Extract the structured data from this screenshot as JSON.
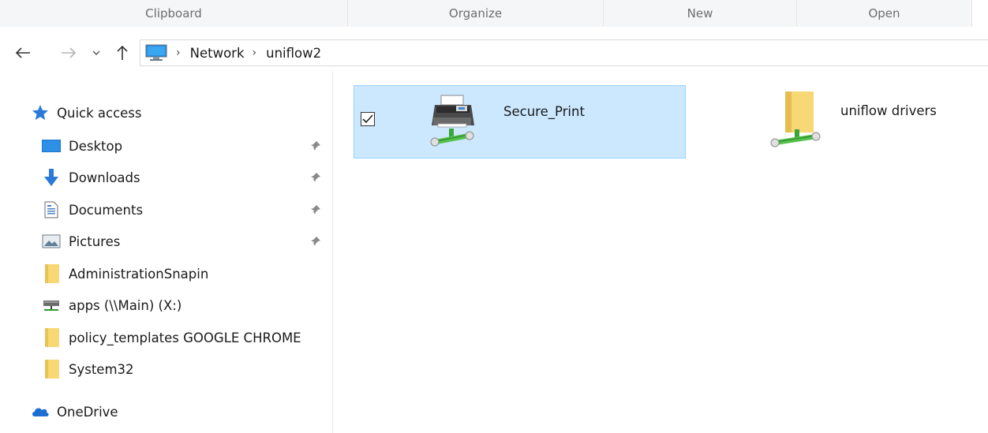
{
  "ribbon": {
    "groups": [
      "Clipboard",
      "Organize",
      "New",
      "Open"
    ]
  },
  "navbar": {
    "back_icon": "arrow-left-icon",
    "forward_icon": "arrow-right-icon",
    "recent_icon": "chevron-down-icon",
    "up_icon": "arrow-up-icon",
    "breadcrumb": [
      "Network",
      "uniflow2"
    ]
  },
  "nav_pane": {
    "quick_access": "Quick access",
    "items": [
      {
        "label": "Desktop",
        "icon": "desktop-icon",
        "pinned": true
      },
      {
        "label": "Downloads",
        "icon": "downloads-icon",
        "pinned": true
      },
      {
        "label": "Documents",
        "icon": "documents-icon",
        "pinned": true
      },
      {
        "label": "Pictures",
        "icon": "pictures-icon",
        "pinned": true
      },
      {
        "label": "AdministrationSnapin",
        "icon": "folder-icon",
        "pinned": false
      },
      {
        "label": "apps (\\\\Main) (X:)",
        "icon": "network-drive-icon",
        "pinned": false
      },
      {
        "label": "policy_templates GOOGLE CHROME",
        "icon": "folder-icon",
        "pinned": false
      },
      {
        "label": "System32",
        "icon": "folder-icon",
        "pinned": false
      }
    ],
    "onedrive": "OneDrive"
  },
  "content": {
    "tiles": [
      {
        "label": "Secure_Print",
        "icon": "network-printer-icon",
        "selected": true
      },
      {
        "label": "uniflow drivers",
        "icon": "network-folder-icon",
        "selected": false
      }
    ]
  },
  "colors": {
    "selection_fill": "#cce8ff",
    "selection_border": "#99d1ff",
    "folder_yellow": "#f8d775",
    "accent_blue": "#1e7fd8"
  }
}
